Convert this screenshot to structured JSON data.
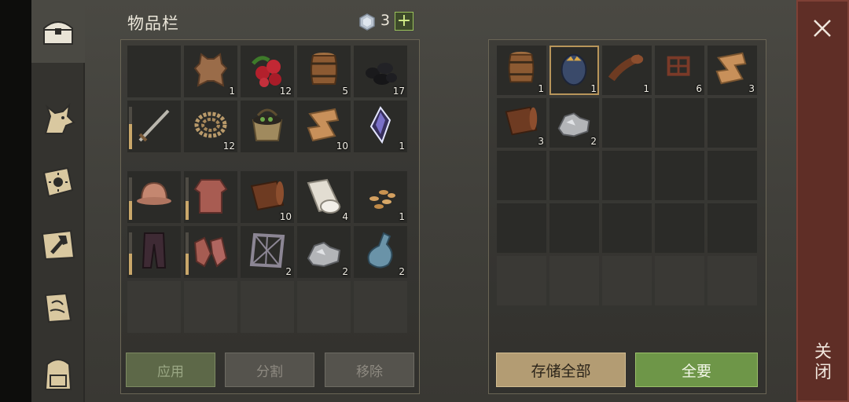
{
  "inventory": {
    "title": "物品栏",
    "gem_count": "3",
    "plus_label": "+",
    "items": [
      {
        "name": "empty-slot",
        "count": ""
      },
      {
        "name": "leather-hide",
        "count": "1"
      },
      {
        "name": "berries",
        "count": "12"
      },
      {
        "name": "barrel",
        "count": "5"
      },
      {
        "name": "coal",
        "count": "17"
      },
      {
        "name": "sword",
        "count": "",
        "durability": 0.6
      },
      {
        "name": "rope",
        "count": "12"
      },
      {
        "name": "basket",
        "count": ""
      },
      {
        "name": "cloth",
        "count": "10"
      },
      {
        "name": "crystal",
        "count": "1"
      }
    ],
    "equipment": [
      {
        "name": "helmet",
        "count": "",
        "durability": 0.45
      },
      {
        "name": "chainmail",
        "count": "",
        "durability": 0.45
      },
      {
        "name": "leather-roll",
        "count": "10"
      },
      {
        "name": "fabric-roll",
        "count": "4"
      },
      {
        "name": "seeds",
        "count": "1"
      },
      {
        "name": "pants",
        "count": "",
        "durability": 0.5
      },
      {
        "name": "gloves",
        "count": "",
        "durability": 0.5
      },
      {
        "name": "frame",
        "count": "2"
      },
      {
        "name": "iron-ore",
        "count": "2"
      },
      {
        "name": "bottle",
        "count": "2"
      }
    ],
    "buttons": {
      "apply": "应用",
      "split": "分割",
      "remove": "移除"
    }
  },
  "storage": {
    "items": [
      {
        "name": "barrel",
        "count": "1"
      },
      {
        "name": "egg",
        "count": "1",
        "selected": true
      },
      {
        "name": "leather-strip",
        "count": "1"
      },
      {
        "name": "scrap",
        "count": "6"
      },
      {
        "name": "cloth",
        "count": "3"
      },
      {
        "name": "leather-roll",
        "count": "3"
      },
      {
        "name": "iron-ore",
        "count": "2"
      }
    ],
    "buttons": {
      "store_all": "存储全部",
      "take_all": "全要"
    }
  },
  "close": {
    "label": "关闭"
  },
  "colors": {
    "accent_green": "#6e9648",
    "accent_tan": "#b39c73",
    "close_red": "#5f2e26"
  }
}
